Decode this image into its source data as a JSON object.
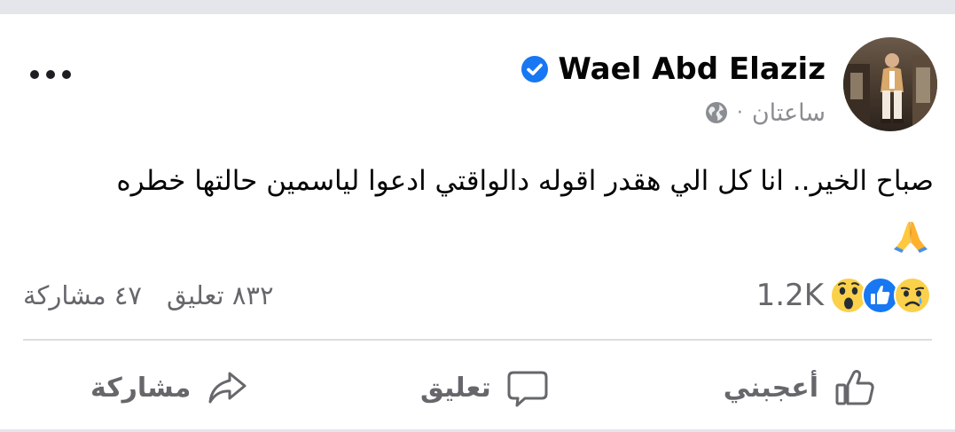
{
  "post": {
    "author": "Wael Abd Elaziz",
    "verified": true,
    "timestamp": "ساعتان",
    "separator": "·",
    "audience_icon": "globe-icon",
    "text": "صباح الخير.. انا كل الي هقدر اقوله دالواقتي ادعوا لياسمين حالتها خطره",
    "emoji": "folded-hands-emoji"
  },
  "stats": {
    "reaction_count": "1.2K",
    "reaction_icons": [
      "sad-reaction-icon",
      "like-reaction-icon",
      "wow-reaction-icon"
    ],
    "comments": "٨٣٢ تعليق",
    "shares": "٤٧ مشاركة"
  },
  "actions": {
    "like_label": "أعجبني",
    "comment_label": "تعليق",
    "share_label": "مشاركة"
  },
  "colors": {
    "verified_blue": "#1877f2",
    "secondary_text": "#65676b",
    "divider": "#dadde1",
    "page_gap": "#e4e6eb"
  }
}
